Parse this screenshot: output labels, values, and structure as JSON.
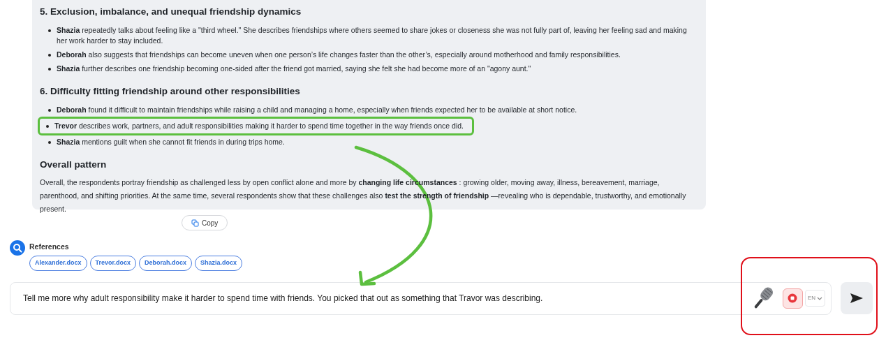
{
  "sections": [
    {
      "heading": "5. Exclusion, imbalance, and unequal friendship dynamics",
      "bullets": [
        {
          "text": "**Shazia** repeatedly talks about feeling like a \"third wheel.\" She describes friendships where others seemed to share jokes or closeness she was not fully part of, leaving her feeling sad and making her work harder to stay included.",
          "highlighted": false
        },
        {
          "text": "**Deborah** also suggests that friendships can become uneven when one person’s life changes faster than the other’s, especially around motherhood and family responsibilities.",
          "highlighted": false
        },
        {
          "text": "**Shazia** further describes one friendship becoming one-sided after the friend got married, saying she felt she had become more of an \"agony aunt.\"",
          "highlighted": false
        }
      ]
    },
    {
      "heading": "6. Difficulty fitting friendship around other responsibilities",
      "bullets": [
        {
          "text": "**Deborah** found it difficult to maintain friendships while raising a child and managing a home, especially when friends expected her to be available at short notice.",
          "highlighted": false
        },
        {
          "text": "**Trevor** describes work, partners, and adult responsibilities making it harder to spend time together in the way friends once did.",
          "highlighted": true
        },
        {
          "text": "**Shazia** mentions guilt when she cannot fit friends in during trips home.",
          "highlighted": false
        }
      ]
    }
  ],
  "overall": {
    "heading": "Overall pattern",
    "text": "Overall, the respondents portray friendship as challenged less by open conflict alone and more by **changing life circumstances** : growing older, moving away, illness, bereavement, marriage, parenthood, and shifting priorities. At the same time, several respondents show that these challenges also **test the strength of friendship** —revealing who is dependable, trustworthy, and emotionally present."
  },
  "copy_button": "Copy",
  "references": {
    "label": "References",
    "files": [
      "Alexander.docx",
      "Trevor.docx",
      "Deborah.docx",
      "Shazia.docx"
    ]
  },
  "input": {
    "value": "Tell me more why adult responsibility make it harder to spend time with friends. You picked that out as something that Travor was describing."
  },
  "language": "EN",
  "annotations": [
    {
      "kind": "arrow",
      "color": "#5cbf3f"
    },
    {
      "kind": "box",
      "color": "#e0101a"
    }
  ]
}
